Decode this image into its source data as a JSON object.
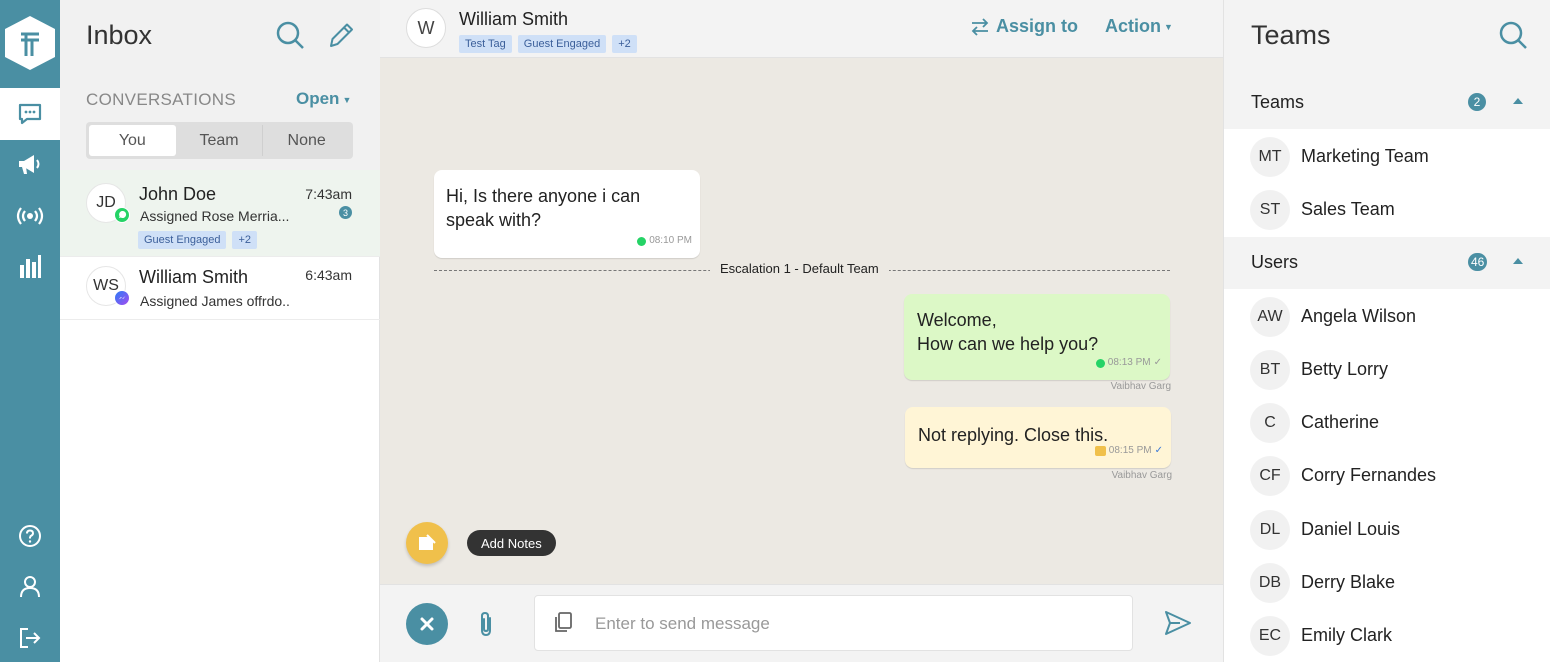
{
  "nav": {
    "items": [
      {
        "name": "chat-icon"
      },
      {
        "name": "megaphone-icon"
      },
      {
        "name": "broadcast-icon"
      },
      {
        "name": "analytics-icon"
      },
      {
        "name": "help-icon"
      },
      {
        "name": "profile-icon"
      },
      {
        "name": "logout-icon"
      }
    ]
  },
  "inbox": {
    "title": "Inbox",
    "conversations_label": "CONVERSATIONS",
    "filter": "Open",
    "segments": [
      "You",
      "Team",
      "None"
    ],
    "active_segment": "You",
    "conversations": [
      {
        "initials": "JD",
        "name": "John Doe",
        "time": "7:43am",
        "preview": "Assigned Rose Merria...",
        "unread": "3",
        "channel": "whatsapp-icon",
        "tags": [
          "Guest Engaged",
          "+2"
        ]
      },
      {
        "initials": "WS",
        "name": "William Smith",
        "time": "6:43am",
        "preview": "Assigned James offrdo..",
        "channel": "messenger-icon"
      }
    ]
  },
  "chat": {
    "contact_initial": "W",
    "contact_name": "William Smith",
    "tags": [
      "Test Tag",
      "Guest Engaged",
      "+2"
    ],
    "assign_label": "Assign to",
    "action_label": "Action",
    "messages": [
      {
        "direction": "in",
        "text": "Hi, Is there anyone i can speak with?",
        "time": "08:10 PM"
      },
      {
        "direction": "out",
        "text_line1": "Welcome,",
        "text_line2": "How can we help you?",
        "time": "08:13 PM",
        "sender": "Vaibhav Garg"
      },
      {
        "direction": "note",
        "text": "Not replying. Close this.",
        "time": "08:15 PM",
        "sender": "Vaibhav Garg"
      }
    ],
    "divider_label": "Escalation 1 - Default Team",
    "notes_tooltip": "Add Notes",
    "composer_placeholder": "Enter to send message"
  },
  "teams_panel": {
    "title": "Teams",
    "teams_section": {
      "label": "Teams",
      "count": "2"
    },
    "teams": [
      {
        "initials": "MT",
        "name": "Marketing Team"
      },
      {
        "initials": "ST",
        "name": "Sales Team"
      }
    ],
    "users_section": {
      "label": "Users",
      "count": "46"
    },
    "users": [
      {
        "initials": "AW",
        "name": "Angela Wilson"
      },
      {
        "initials": "BT",
        "name": "Betty Lorry"
      },
      {
        "initials": "C",
        "name": "Catherine"
      },
      {
        "initials": "CF",
        "name": "Corry Fernandes"
      },
      {
        "initials": "DL",
        "name": "Daniel Louis"
      },
      {
        "initials": "DB",
        "name": "Derry Blake"
      },
      {
        "initials": "EC",
        "name": "Emily Clark"
      }
    ]
  },
  "colors": {
    "accent": "#4a8fa3",
    "incoming_bubble": "#ffffff",
    "outgoing_bubble": "#dcf8c6",
    "note_bubble": "#fff5d6",
    "notes_button": "#f0c04b"
  }
}
